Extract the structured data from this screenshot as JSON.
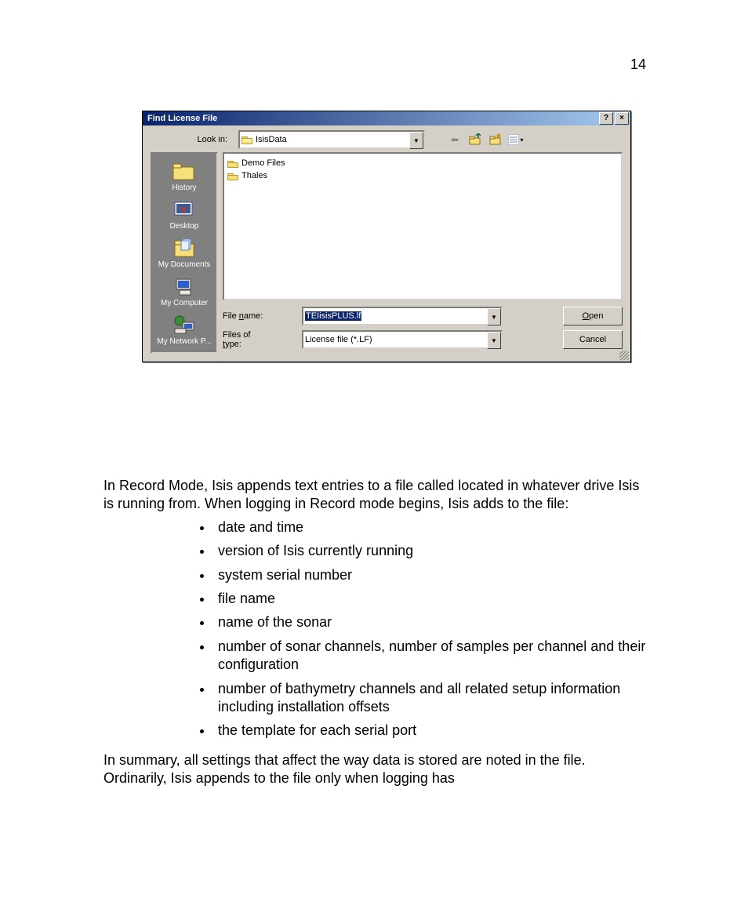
{
  "page_number": "14",
  "dialog": {
    "title": "Find License File",
    "look_in_label": "Look in:",
    "look_in_value": "IsisData",
    "places": [
      {
        "label": "History"
      },
      {
        "label": "Desktop"
      },
      {
        "label": "My Documents"
      },
      {
        "label": "My Computer"
      },
      {
        "label": "My Network P..."
      }
    ],
    "file_items": [
      "Demo Files",
      "Thales"
    ],
    "file_name_label": "File name:",
    "file_name_value": "TEIisisPLUS.lf",
    "files_of_type_label": "Files of type:",
    "files_of_type_value": "License file (*.LF)",
    "open_prefix": "O",
    "open_rest": "pen",
    "cancel_label": "Cancel",
    "help_glyph": "?",
    "close_glyph": "×",
    "dropdown_glyph": "▼",
    "back_glyph": "⬅",
    "view_glyph": "▾"
  },
  "body": {
    "para1": "In Record Mode, Isis appends text entries to a file called                        located in whatever drive Isis is running from. When logging in Record mode begins, Isis adds to the file:",
    "bullets": [
      "date and time",
      "version of Isis currently running",
      "system serial number",
      "file name",
      "name of the sonar",
      "number of sonar channels, number of samples per channel and their configuration",
      "number of bathymetry channels and all related setup information including installation offsets",
      "the template for each serial port"
    ],
    "para2": "In summary, all settings that affect the way data is stored are noted in the                         file. Ordinarily, Isis appends to the file only when logging has"
  }
}
